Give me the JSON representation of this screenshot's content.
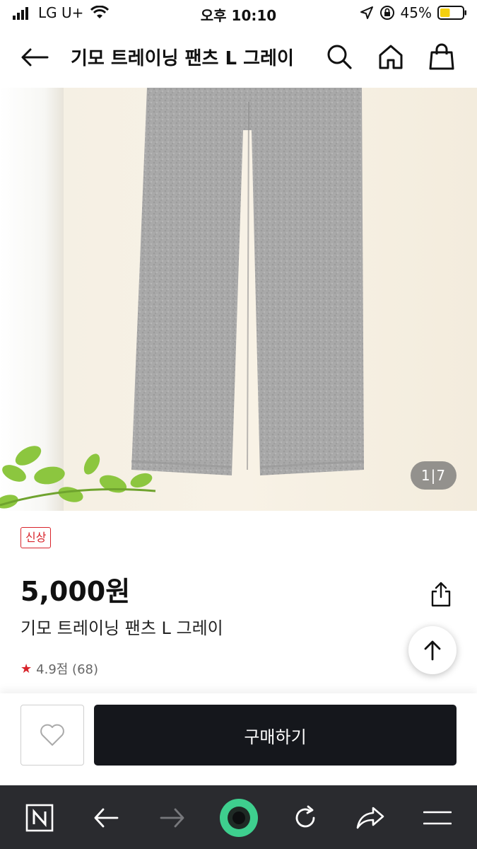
{
  "status_bar": {
    "carrier": "LG U+",
    "time": "오후 10:10",
    "battery_percent": "45%",
    "battery_level": 0.45
  },
  "header": {
    "title": "기모 트레이닝 팬츠 L 그레이"
  },
  "gallery": {
    "counter": "1|7",
    "current": 1,
    "total": 7
  },
  "product": {
    "badge": "신상",
    "price": "5,000원",
    "name": "기모 트레이닝 팬츠 L 그레이",
    "rating_text": "4.9점 (68)"
  },
  "purchase": {
    "buy_label": "구매하기"
  },
  "colors": {
    "accent_red": "#d8232a",
    "buy_button": "#15171c",
    "toolbar_bg": "#2a2b2f",
    "toolbar_green": "#3ecf8e"
  }
}
